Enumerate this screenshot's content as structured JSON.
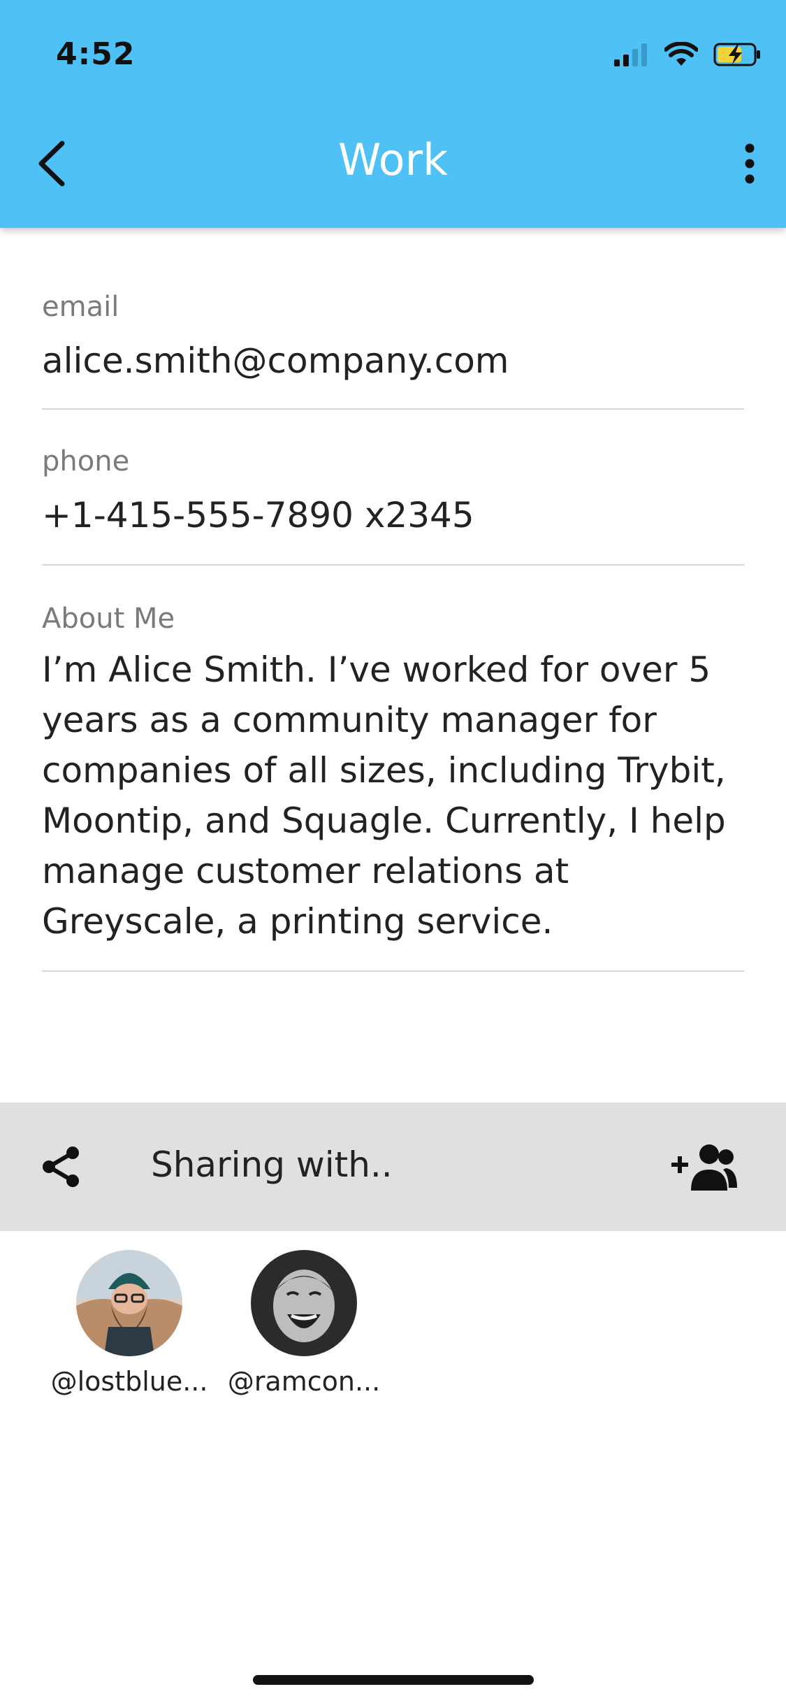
{
  "status_bar": {
    "time": "4:52",
    "icons": [
      "signal-icon",
      "wifi-icon",
      "battery-charging-icon"
    ]
  },
  "header": {
    "title": "Work",
    "back_icon": "chevron-left-icon",
    "menu_icon": "more-vert-icon",
    "background_color": "#4fc1f5"
  },
  "fields": {
    "email": {
      "label": "email",
      "value": "alice.smith@company.com"
    },
    "phone": {
      "label": "phone",
      "value": "+1-415-555-7890 x2345"
    },
    "about": {
      "label": "About Me",
      "value": "I’m Alice Smith. I’ve worked for over 5 years as a community manager for companies of all sizes, including Trybit, Moontip, and Squagle. Currently, I help manage customer relations at Greyscale, a printing service."
    }
  },
  "sharing": {
    "label": "Sharing with..",
    "share_icon": "share-icon",
    "add_icon": "add-group-icon",
    "contacts": [
      {
        "handle": "@lostblue..."
      },
      {
        "handle": "@ramcon..."
      }
    ]
  }
}
